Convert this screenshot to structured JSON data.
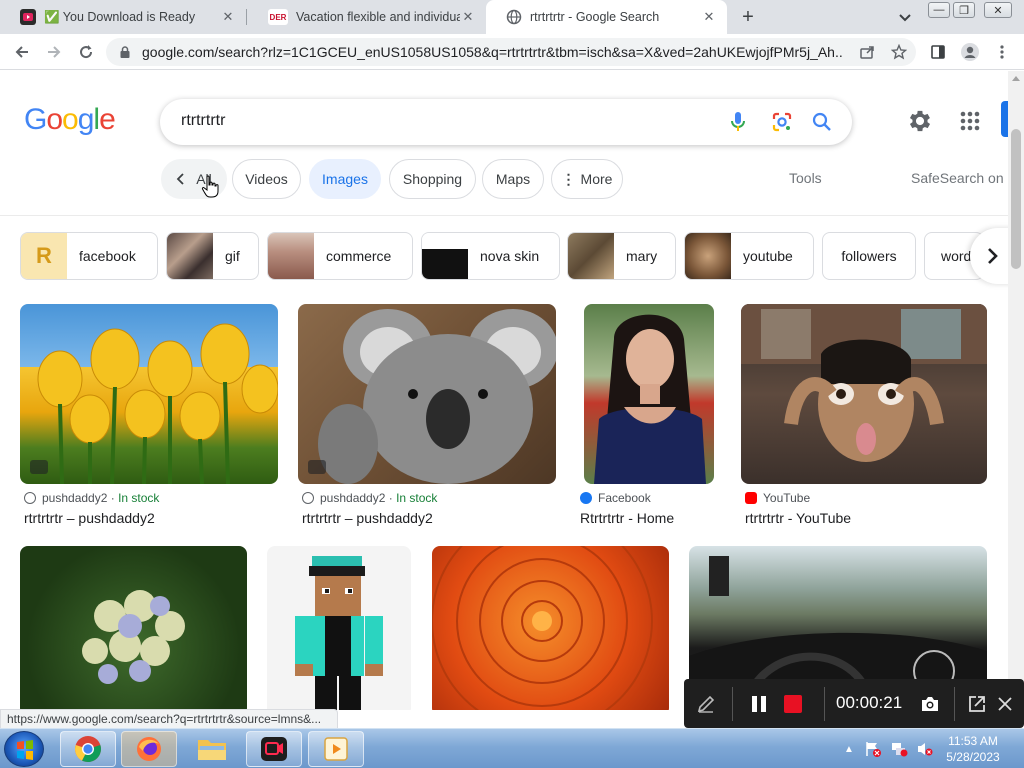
{
  "browser": {
    "tabs": [
      {
        "title": "✅ You Download is Ready",
        "favicon": "video-download-icon"
      },
      {
        "title": "Vacation flexible and individual w",
        "favicon": "der-travel-icon",
        "favicon_text": "DER"
      },
      {
        "title": "rtrtrtrtr - Google Search",
        "favicon": "google-icon"
      }
    ],
    "url": "google.com/search?rlz=1C1GCEU_enUS1058US1058&q=rtrtrtrtr&tbm=isch&sa=X&ved=2ahUKEwjojfPMr5j_Ah..."
  },
  "google": {
    "logo": "Google",
    "query": "rtrtrtrtr",
    "chips": {
      "all": "All",
      "videos": "Videos",
      "images": "Images",
      "shopping": "Shopping",
      "maps": "Maps",
      "more": "More"
    },
    "tools": "Tools",
    "safesearch": "SafeSearch on",
    "related": [
      {
        "label": "facebook",
        "thumb_text": "R"
      },
      {
        "label": "gif"
      },
      {
        "label": "commerce"
      },
      {
        "label": "nova skin"
      },
      {
        "label": "mary"
      },
      {
        "label": "youtube"
      },
      {
        "label": "followers"
      },
      {
        "label": "word"
      }
    ],
    "results": [
      {
        "source": "pushdaddy2",
        "stock": "In stock",
        "caption": "rtrtrtrtr – pushdaddy2"
      },
      {
        "source": "pushdaddy2",
        "stock": "In stock",
        "caption": "rtrtrtrtr – pushdaddy2"
      },
      {
        "source": "Facebook",
        "caption": "Rtrtrtrtr - Home"
      },
      {
        "source": "YouTube",
        "caption": "rtrtrtrtr - YouTube"
      }
    ]
  },
  "status_url": "https://www.google.com/search?q=rtrtrtrtr&source=lmns&...",
  "recorder": {
    "timer": "00:00:21"
  },
  "taskbar": {
    "time": "11:53 AM",
    "date": "5/28/2023"
  },
  "colors": {
    "google_blue": "#4285F4",
    "google_red": "#EA4335",
    "google_yellow": "#FBBC05",
    "google_green": "#34A853",
    "record_red": "#e81123"
  }
}
